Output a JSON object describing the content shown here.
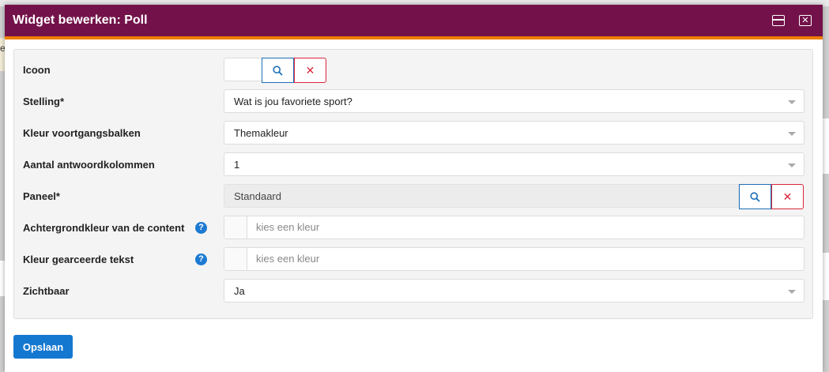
{
  "dialog": {
    "title": "Widget bewerken: Poll"
  },
  "background": {
    "left_fragment": "e"
  },
  "form": {
    "icon": {
      "label": "Icoon",
      "search_symbol": "🔍",
      "clear_symbol": "✕"
    },
    "statement": {
      "label": "Stelling*",
      "value": "Wat is jou favoriete sport?"
    },
    "progress_color": {
      "label": "Kleur voortgangsbalken",
      "value": "Themakleur"
    },
    "columns": {
      "label": "Aantal antwoordkolommen",
      "value": "1"
    },
    "panel": {
      "label": "Paneel*",
      "value": "Standaard"
    },
    "content_bg_color": {
      "label": "Achtergrondkleur van de content",
      "placeholder": "kies een kleur",
      "help": "?"
    },
    "text_color": {
      "label": "Kleur gearceerde tekst",
      "placeholder": "kies een kleur",
      "help": "?"
    },
    "visible": {
      "label": "Zichtbaar",
      "value": "Ja"
    }
  },
  "actions": {
    "save_label": "Opslaan"
  },
  "colors": {
    "titlebar": "#73124a",
    "accent": "#f07d00",
    "primary": "#1578d0",
    "danger": "#d9263b"
  }
}
